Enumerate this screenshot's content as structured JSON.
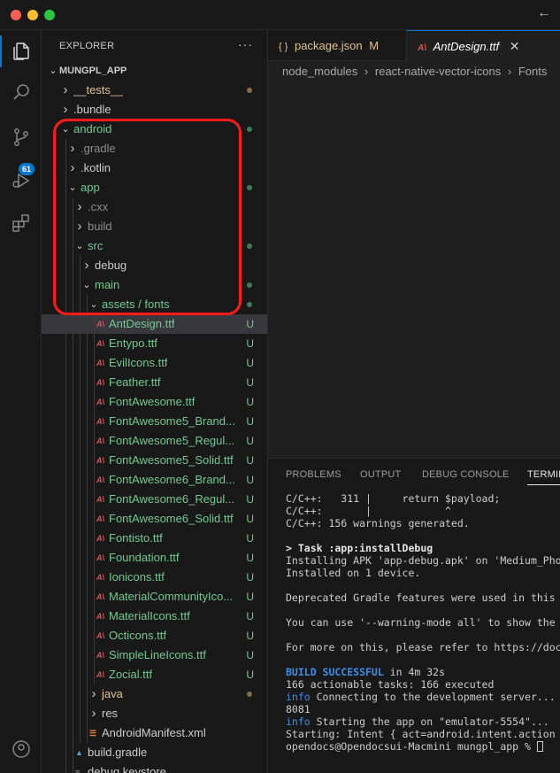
{
  "colors": {
    "folder_text": "#cccccc",
    "dim_text": "#8c8c8c",
    "untracked_green": "#73c991",
    "modified_yellow": "#e2c08d",
    "accent": "#0078d4",
    "annotation": "#ff1a1a"
  },
  "titlebar": {
    "back_icon": "arrow-left-icon"
  },
  "activity_bar": {
    "items": [
      "explorer-icon",
      "search-icon",
      "source-control-icon",
      "run-debug-icon",
      "extensions-icon",
      "account-icon"
    ],
    "scm_badge": "61"
  },
  "explorer": {
    "title": "EXPLORER",
    "more": "···",
    "root": "MUNGPL_APP",
    "rows": [
      {
        "label": "__tests__",
        "depth": 1,
        "type": "folder",
        "open": false,
        "color": "yellow",
        "status": "dot-yellow"
      },
      {
        "label": ".bundle",
        "depth": 1,
        "type": "folder",
        "open": false,
        "color": "default",
        "status": ""
      },
      {
        "label": "android",
        "depth": 1,
        "type": "folder",
        "open": true,
        "color": "green",
        "status": "dot-green"
      },
      {
        "label": ".gradle",
        "depth": 2,
        "type": "folder",
        "open": false,
        "color": "dim",
        "status": ""
      },
      {
        "label": ".kotlin",
        "depth": 2,
        "type": "folder",
        "open": false,
        "color": "default",
        "status": ""
      },
      {
        "label": "app",
        "depth": 2,
        "type": "folder",
        "open": true,
        "color": "green",
        "status": "dot-green"
      },
      {
        "label": ".cxx",
        "depth": 3,
        "type": "folder",
        "open": false,
        "color": "dim",
        "status": ""
      },
      {
        "label": "build",
        "depth": 3,
        "type": "folder",
        "open": false,
        "color": "dim",
        "status": ""
      },
      {
        "label": "src",
        "depth": 3,
        "type": "folder",
        "open": true,
        "color": "green",
        "status": "dot-green"
      },
      {
        "label": "debug",
        "depth": 4,
        "type": "folder",
        "open": false,
        "color": "default",
        "status": ""
      },
      {
        "label": "main",
        "depth": 4,
        "type": "folder",
        "open": true,
        "color": "green",
        "status": "dot-green"
      },
      {
        "label": "assets / fonts",
        "depth": 5,
        "type": "folder",
        "open": true,
        "color": "green",
        "status": "dot-green"
      },
      {
        "label": "AntDesign.ttf",
        "depth": 6,
        "type": "font",
        "color": "green",
        "status": "U",
        "selected": true
      },
      {
        "label": "Entypo.ttf",
        "depth": 6,
        "type": "font",
        "color": "green",
        "status": "U"
      },
      {
        "label": "EvilIcons.ttf",
        "depth": 6,
        "type": "font",
        "color": "green",
        "status": "U"
      },
      {
        "label": "Feather.ttf",
        "depth": 6,
        "type": "font",
        "color": "green",
        "status": "U"
      },
      {
        "label": "FontAwesome.ttf",
        "depth": 6,
        "type": "font",
        "color": "green",
        "status": "U"
      },
      {
        "label": "FontAwesome5_Brand...",
        "depth": 6,
        "type": "font",
        "color": "green",
        "status": "U"
      },
      {
        "label": "FontAwesome5_Regul...",
        "depth": 6,
        "type": "font",
        "color": "green",
        "status": "U"
      },
      {
        "label": "FontAwesome5_Solid.ttf",
        "depth": 6,
        "type": "font",
        "color": "green",
        "status": "U"
      },
      {
        "label": "FontAwesome6_Brand...",
        "depth": 6,
        "type": "font",
        "color": "green",
        "status": "U"
      },
      {
        "label": "FontAwesome6_Regul...",
        "depth": 6,
        "type": "font",
        "color": "green",
        "status": "U"
      },
      {
        "label": "FontAwesome6_Solid.ttf",
        "depth": 6,
        "type": "font",
        "color": "green",
        "status": "U"
      },
      {
        "label": "Fontisto.ttf",
        "depth": 6,
        "type": "font",
        "color": "green",
        "status": "U"
      },
      {
        "label": "Foundation.ttf",
        "depth": 6,
        "type": "font",
        "color": "green",
        "status": "U"
      },
      {
        "label": "Ionicons.ttf",
        "depth": 6,
        "type": "font",
        "color": "green",
        "status": "U"
      },
      {
        "label": "MaterialCommunityIco...",
        "depth": 6,
        "type": "font",
        "color": "green",
        "status": "U"
      },
      {
        "label": "MaterialIcons.ttf",
        "depth": 6,
        "type": "font",
        "color": "green",
        "status": "U"
      },
      {
        "label": "Octicons.ttf",
        "depth": 6,
        "type": "font",
        "color": "green",
        "status": "U"
      },
      {
        "label": "SimpleLineIcons.ttf",
        "depth": 6,
        "type": "font",
        "color": "green",
        "status": "U"
      },
      {
        "label": "Zocial.ttf",
        "depth": 6,
        "type": "font",
        "color": "green",
        "status": "U"
      },
      {
        "label": "java",
        "depth": 5,
        "type": "folder",
        "open": false,
        "color": "yellow",
        "status": "dot-yellow"
      },
      {
        "label": "res",
        "depth": 5,
        "type": "folder",
        "open": false,
        "color": "default",
        "status": ""
      },
      {
        "label": "AndroidManifest.xml",
        "depth": 5,
        "type": "xml",
        "color": "default",
        "status": ""
      },
      {
        "label": "build.gradle",
        "depth": 3,
        "type": "gradle",
        "color": "default",
        "status": ""
      },
      {
        "label": "debug.keystore",
        "depth": 3,
        "type": "file",
        "color": "default",
        "status": ""
      }
    ]
  },
  "editor": {
    "tabs": [
      {
        "icon": "{ }",
        "label": "package.json",
        "status": "M",
        "active": false
      },
      {
        "icon": "A\\",
        "label": "AntDesign.ttf",
        "status": "",
        "active": true
      }
    ],
    "close_icon": "close-icon",
    "breadcrumb": [
      "node_modules",
      "react-native-vector-icons",
      "Fonts"
    ],
    "breadcrumb_sep": "›"
  },
  "panel": {
    "tabs": [
      "PROBLEMS",
      "OUTPUT",
      "DEBUG CONSOLE",
      "TERMINAL"
    ],
    "active_tab": "TERMINAL",
    "terminal_lines": [
      {
        "type": "plain",
        "text": "C/C++:   311 |     return $payload;"
      },
      {
        "type": "plain",
        "text": "C/C++:       |            ^"
      },
      {
        "type": "plain",
        "text": "C/C++: 156 warnings generated."
      },
      {
        "type": "blank",
        "text": ""
      },
      {
        "type": "bold",
        "text": "> Task :app:installDebug"
      },
      {
        "type": "plain",
        "text": "Installing APK 'app-debug.apk' on 'Medium_Pho"
      },
      {
        "type": "plain",
        "text": "Installed on 1 device."
      },
      {
        "type": "blank",
        "text": ""
      },
      {
        "type": "plain",
        "text": "Deprecated Gradle features were used in this"
      },
      {
        "type": "blank",
        "text": ""
      },
      {
        "type": "plain",
        "text": "You can use '--warning-mode all' to show the"
      },
      {
        "type": "blank",
        "text": ""
      },
      {
        "type": "plain",
        "text": "For more on this, please refer to https://doc"
      },
      {
        "type": "blank",
        "text": ""
      },
      {
        "type": "success",
        "prefix": "BUILD SUCCESSFUL",
        "text": " in 4m 32s"
      },
      {
        "type": "plain",
        "text": "166 actionable tasks: 166 executed"
      },
      {
        "type": "info",
        "prefix": "info",
        "text": " Connecting to the development server..."
      },
      {
        "type": "plain",
        "text": "8081"
      },
      {
        "type": "info",
        "prefix": "info",
        "text": " Starting the app on \"emulator-5554\"..."
      },
      {
        "type": "plain",
        "text": "Starting: Intent { act=android.intent.action"
      },
      {
        "type": "prompt",
        "text": "opendocs@Opendocsui-Macmini mungpl_app % "
      }
    ]
  }
}
